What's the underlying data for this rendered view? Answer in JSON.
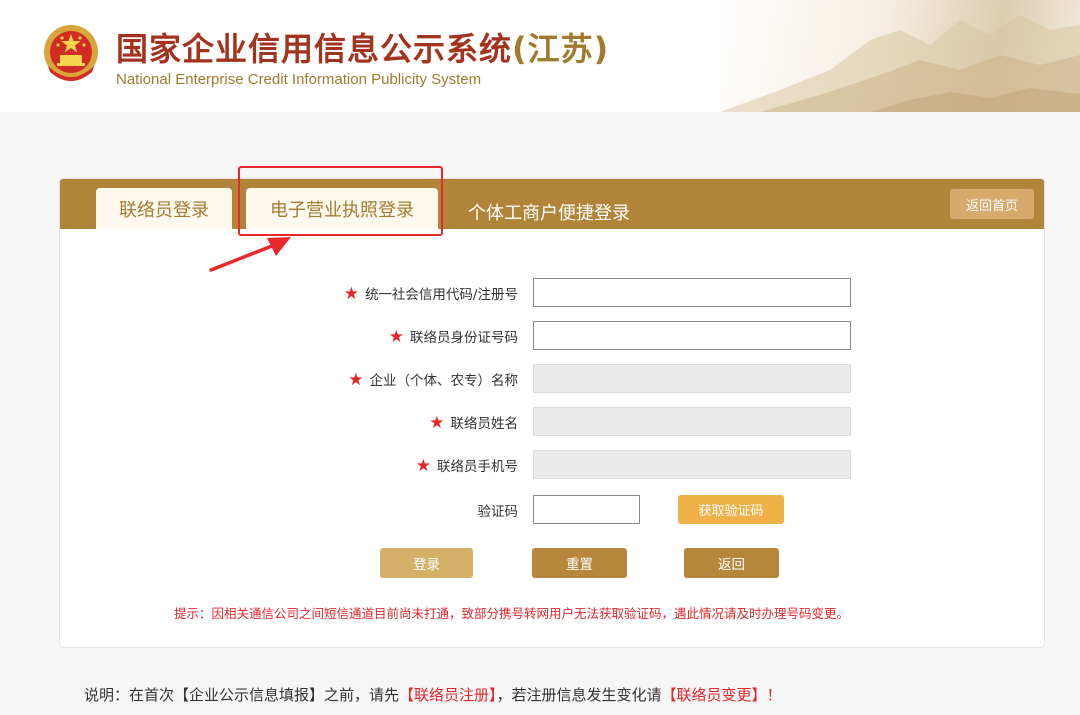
{
  "header": {
    "title_main": "国家企业信用信息公示系统",
    "title_province": "(江苏)",
    "subtitle": "National Enterprise Credit Information Publicity System"
  },
  "tabs": [
    {
      "label": "联络员登录"
    },
    {
      "label": "电子营业执照登录"
    },
    {
      "label": "个体工商户便捷登录"
    }
  ],
  "back_home_label": "返回首页",
  "form": {
    "required_mark": "★",
    "fields": [
      {
        "label": "统一社会信用代码/注册号",
        "value": "",
        "required": true,
        "disabled": false
      },
      {
        "label": "联络员身份证号码",
        "value": "",
        "required": true,
        "disabled": false
      },
      {
        "label": "企业（个体、农专）名称",
        "value": "",
        "required": true,
        "disabled": true
      },
      {
        "label": "联络员姓名",
        "value": "",
        "required": true,
        "disabled": true
      },
      {
        "label": "联络员手机号",
        "value": "",
        "required": true,
        "disabled": true
      }
    ],
    "captcha": {
      "label": "验证码",
      "value": "",
      "button_label": "获取验证码"
    },
    "buttons": {
      "login": "登录",
      "reset": "重置",
      "back": "返回"
    },
    "tip": "提示：因相关通信公司之间短信通道目前尚未打通，致部分携号转网用户无法获取验证码，遇此情况请及时办理号码变更。"
  },
  "note": {
    "prefix": "说明：在首次【企业公示信息填报】之前，请先",
    "link_register": "【联络员注册】",
    "middle": "，若注册信息发生变化请",
    "link_change": "【联络员变更】",
    "suffix": "！"
  },
  "colors": {
    "brand_red": "#a3331f",
    "brand_gold": "#a27a2e",
    "tab_bar": "#b0853a",
    "required_star": "#e3262a",
    "annotation_red": "#e8282b"
  }
}
